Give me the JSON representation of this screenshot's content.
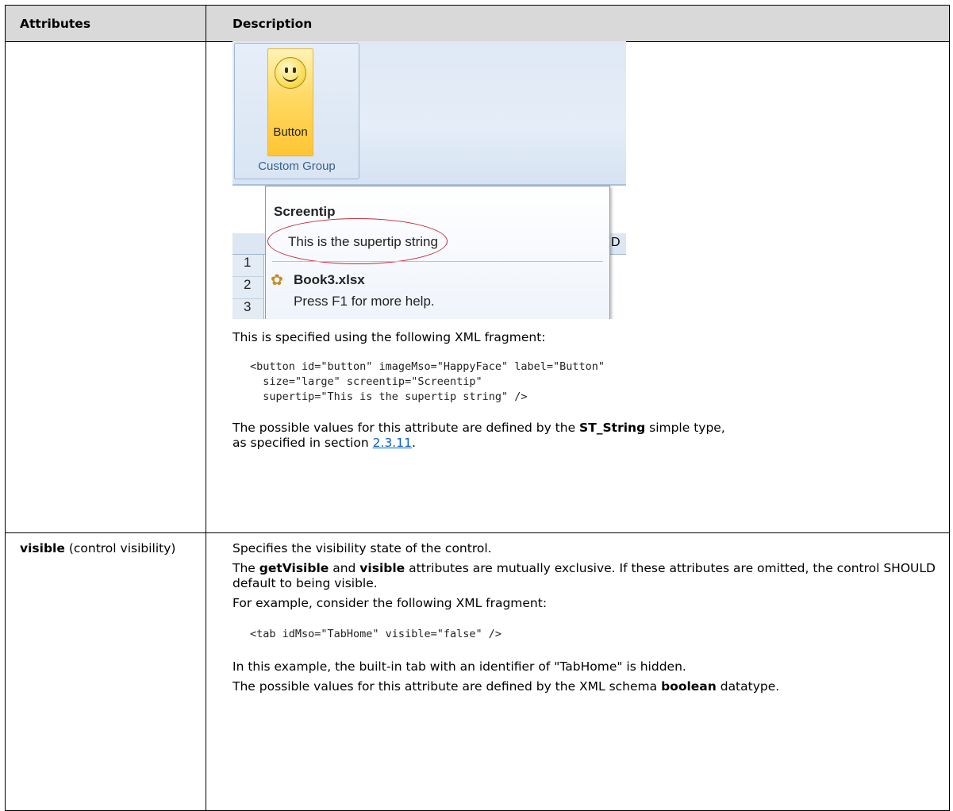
{
  "table": {
    "headers": [
      "Attributes",
      "Description"
    ],
    "row1": {
      "name_bold": "",
      "name_rest": "",
      "screenshot": {
        "button_label": "Button",
        "group_label": "Custom Group",
        "screentip_title": "Screentip",
        "supertip_text": "This is the supertip string",
        "file_name": "Book3.xlsx",
        "help_text": "Press F1 for more help.",
        "row_numbers": [
          "1",
          "2",
          "3"
        ],
        "column_letter": "D"
      },
      "intro": "This is specified using the following XML fragment:",
      "code": "<button id=\"button\" imageMso=\"HappyFace\" label=\"Button\"\n  size=\"large\" screentip=\"Screentip\"\n  supertip=\"This is the supertip string\" />",
      "values_pre": "The possible values for this attribute are defined by the ",
      "values_type": "ST_String",
      "values_mid": " simple type,",
      "values_line2_pre": "as specified in section ",
      "values_link": "2.3.11",
      "values_end": "."
    },
    "row2": {
      "name_bold": "visible",
      "name_rest": " (control visibility)",
      "p1": "Specifies the visibility state of the control.",
      "p2_pre": "The ",
      "p2_b1": "getVisible",
      "p2_mid": " and ",
      "p2_b2": "visible",
      "p2_post": " attributes are mutually exclusive. If these attributes are omitted, the control SHOULD default to being visible.",
      "p3": "For example, consider the following XML fragment:",
      "code": "<tab idMso=\"TabHome\" visible=\"false\" />",
      "p4": "In this example, the built-in tab with an identifier of \"TabHome\" is hidden.",
      "p5_pre": "The possible values for this attribute are defined by the XML schema ",
      "p5_b": "boolean",
      "p5_post": " datatype."
    }
  }
}
